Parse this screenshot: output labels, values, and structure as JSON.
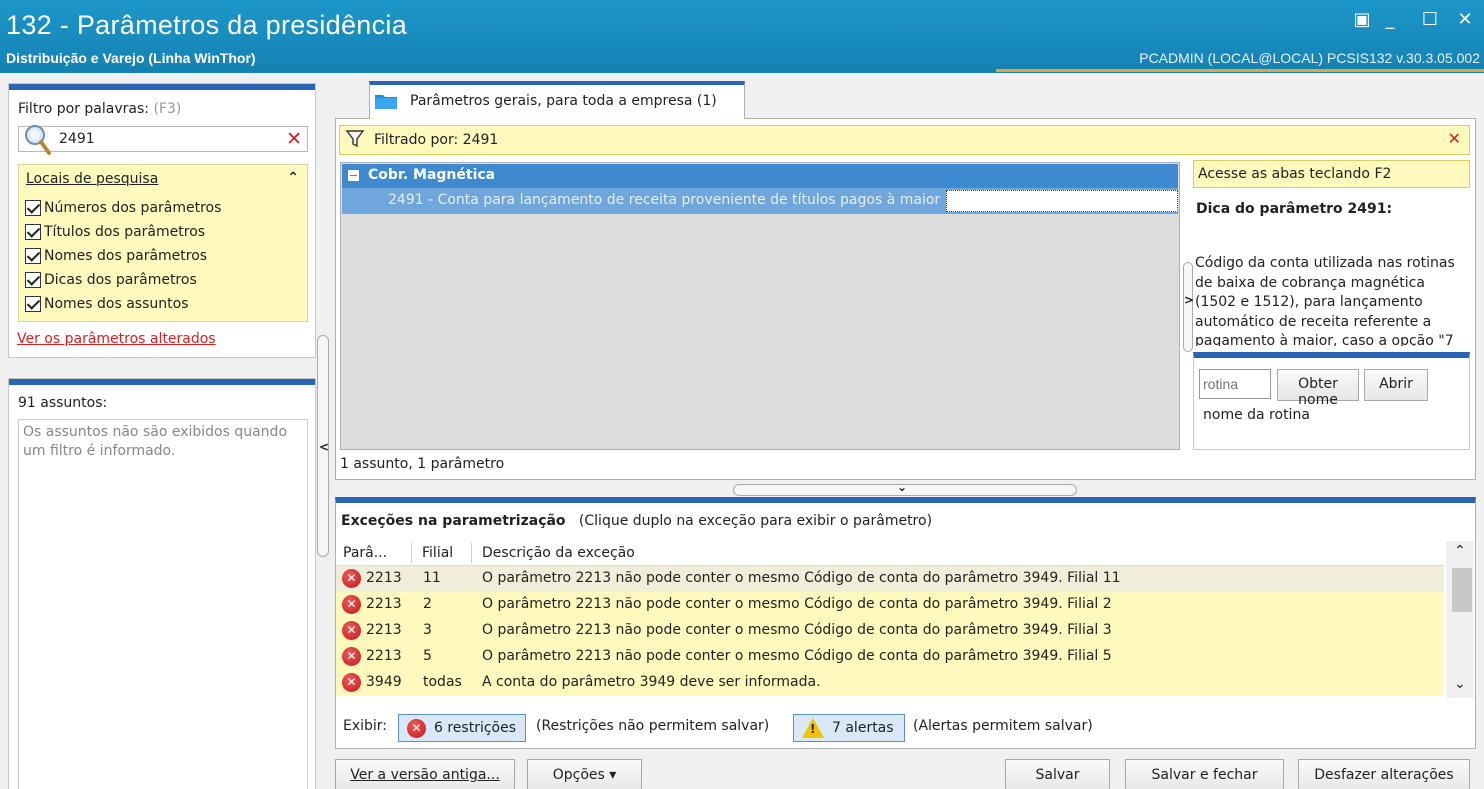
{
  "window": {
    "title": "132 - Parâmetros da presidência",
    "subtitle": "Distribuição e Varejo (Linha WinThor)",
    "user_info": "PCADMIN (LOCAL@LOCAL)   PCSIS132  v.30.3.05.002",
    "controls": {
      "restore": "▣",
      "minimize": "_",
      "maximize": "☐",
      "close": "✕"
    }
  },
  "filter": {
    "label": "Filtro por palavras:",
    "shortcut": "(F3)",
    "search_value": "2491",
    "clear_icon": "✕",
    "locations": {
      "header": "Locais de pesquisa",
      "collapse_icon": "⌃",
      "items": [
        {
          "label": "Números dos parâmetros",
          "checked": true
        },
        {
          "label": "Títulos dos parâmetros",
          "checked": true
        },
        {
          "label": "Nomes dos parâmetros",
          "checked": true
        },
        {
          "label": "Dicas dos parâmetros",
          "checked": true
        },
        {
          "label": "Nomes dos assuntos",
          "checked": true
        }
      ]
    },
    "altered_link": "Ver os parâmetros alterados"
  },
  "subjects": {
    "count_label": "91 assuntos:",
    "empty_message": "Os assuntos não são exibidos quando um filtro é informado."
  },
  "tab": {
    "label": "Parâmetros gerais, para toda a empresa  (1)"
  },
  "filtered_bar": {
    "text": "Filtrado por: 2491",
    "close_icon": "✕"
  },
  "tree": {
    "group": "Cobr. Magnética",
    "item": "2491 - Conta para lançamento de receita proveniente de títulos pagos à maior"
  },
  "status_count": "1 assunto, 1 parâmetro",
  "hint": {
    "tab_label": "Acesse as abas teclando F2",
    "title": "Dica do parâmetro 2491:",
    "text": "Código da conta utilizada nas rotinas de baixa de cobrança magnética (1502 e 1512), para lançamento automático de receita referente a pagamento à maior, caso a opção \"7",
    "rotina_placeholder": "rotina",
    "get_name_button": "Obter nome",
    "open_button": "Abrir",
    "rotina_name": "nome da rotina"
  },
  "exceptions": {
    "title_bold": "Exceções na parametrização",
    "title_hint": "(Clique duplo na exceção para exibir o parâmetro)",
    "columns": [
      "Parâ...",
      "Filial",
      "Descrição da exceção"
    ],
    "rows": [
      {
        "param": "2213",
        "filial": "11",
        "desc": "O parâmetro 2213 não pode conter o mesmo Código de conta do parâmetro 3949. Filial 11"
      },
      {
        "param": "2213",
        "filial": "2",
        "desc": "O parâmetro 2213 não pode conter o mesmo Código de conta do parâmetro 3949. Filial 2"
      },
      {
        "param": "2213",
        "filial": "3",
        "desc": "O parâmetro 2213 não pode conter o mesmo Código de conta do parâmetro 3949. Filial 3"
      },
      {
        "param": "2213",
        "filial": "5",
        "desc": "O parâmetro 2213 não pode conter o mesmo Código de conta do parâmetro 3949. Filial 5"
      },
      {
        "param": "3949",
        "filial": "todas",
        "desc": "A conta do parâmetro 3949 deve ser informada."
      }
    ],
    "show_label": "Exibir:",
    "restrictions_button": "6 restrições",
    "restrictions_note": "(Restrições não permitem salvar)",
    "alerts_button": "7 alertas",
    "alerts_note": "(Alertas permitem salvar)"
  },
  "buttons": {
    "old_version": "Ver a versão antiga...",
    "options": "Opções ▾",
    "save": "Salvar",
    "save_close": "Salvar e fechar",
    "undo": "Desfazer alterações"
  }
}
